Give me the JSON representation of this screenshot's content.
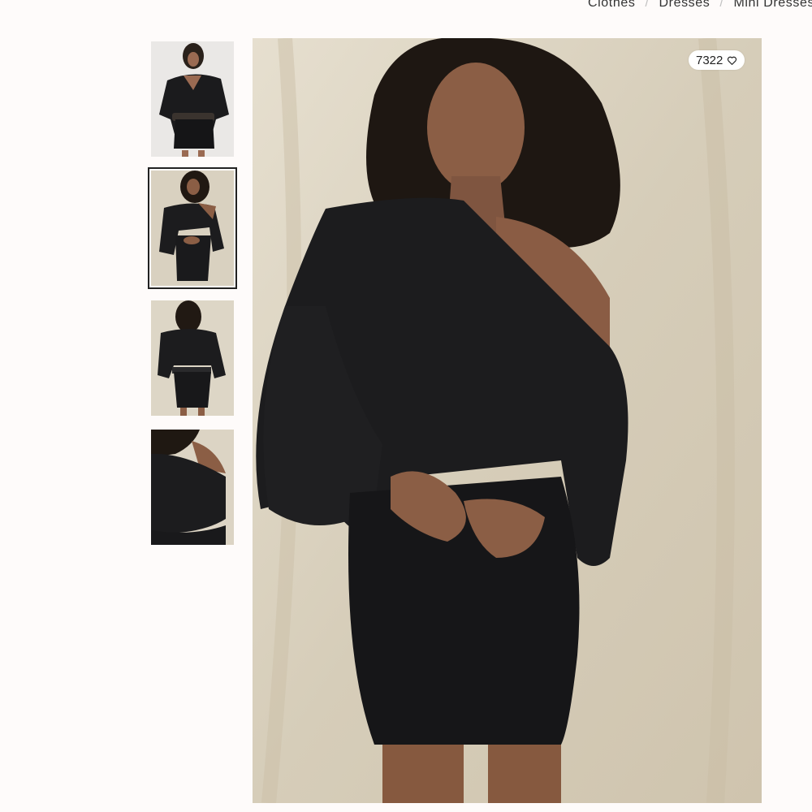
{
  "breadcrumb": {
    "items": [
      "Clothes",
      "Dresses",
      "Mini Dresses"
    ],
    "separator": "/"
  },
  "gallery": {
    "thumbnails": [
      {
        "icon": "model-photo-belted-front",
        "active": false
      },
      {
        "icon": "model-photo-front",
        "active": true
      },
      {
        "icon": "model-photo-back",
        "active": false
      },
      {
        "icon": "model-photo-shoulder-detail",
        "active": false
      }
    ],
    "main_image_icon": "model-photo-front-large"
  },
  "favorites": {
    "count": "7322",
    "icon": "heart-outline-icon"
  },
  "colors": {
    "page_bg": "#fefbfa",
    "backdrop": "#dbd3c1",
    "dress": "#1c1c1e",
    "skin": "#8b5e45",
    "hair": "#1e1712"
  }
}
